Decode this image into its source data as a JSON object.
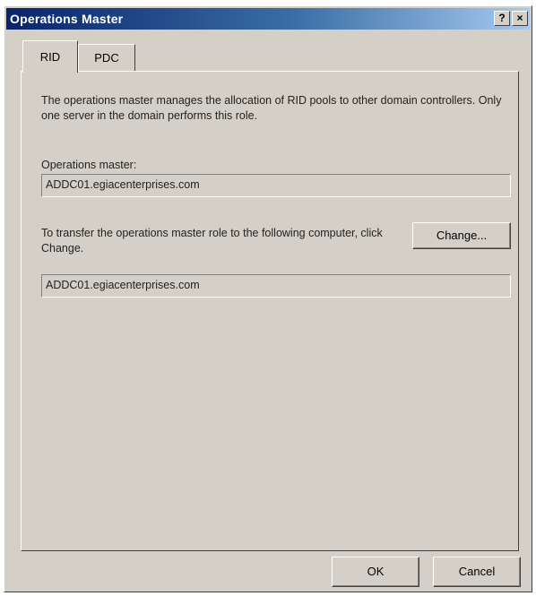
{
  "window": {
    "title": "Operations Master",
    "help_button": "?",
    "close_button": "×"
  },
  "tabs": [
    {
      "label": "RID",
      "active": true
    },
    {
      "label": "PDC",
      "active": false
    }
  ],
  "rid_tab": {
    "description": "The operations master manages the allocation of RID pools to other domain controllers. Only one server in the domain performs this role.",
    "operations_master_label": "Operations master:",
    "operations_master_value": "ADDC01.egiacenterprises.com",
    "transfer_text": "To transfer the operations master role to the following computer, click Change.",
    "change_button": "Change...",
    "transfer_target_value": "ADDC01.egiacenterprises.com"
  },
  "footer": {
    "ok_label": "OK",
    "cancel_label": "Cancel"
  },
  "colors": {
    "dialog_face": "#d4d0c8",
    "title_start": "#0a246a",
    "title_end": "#a6caf0"
  }
}
